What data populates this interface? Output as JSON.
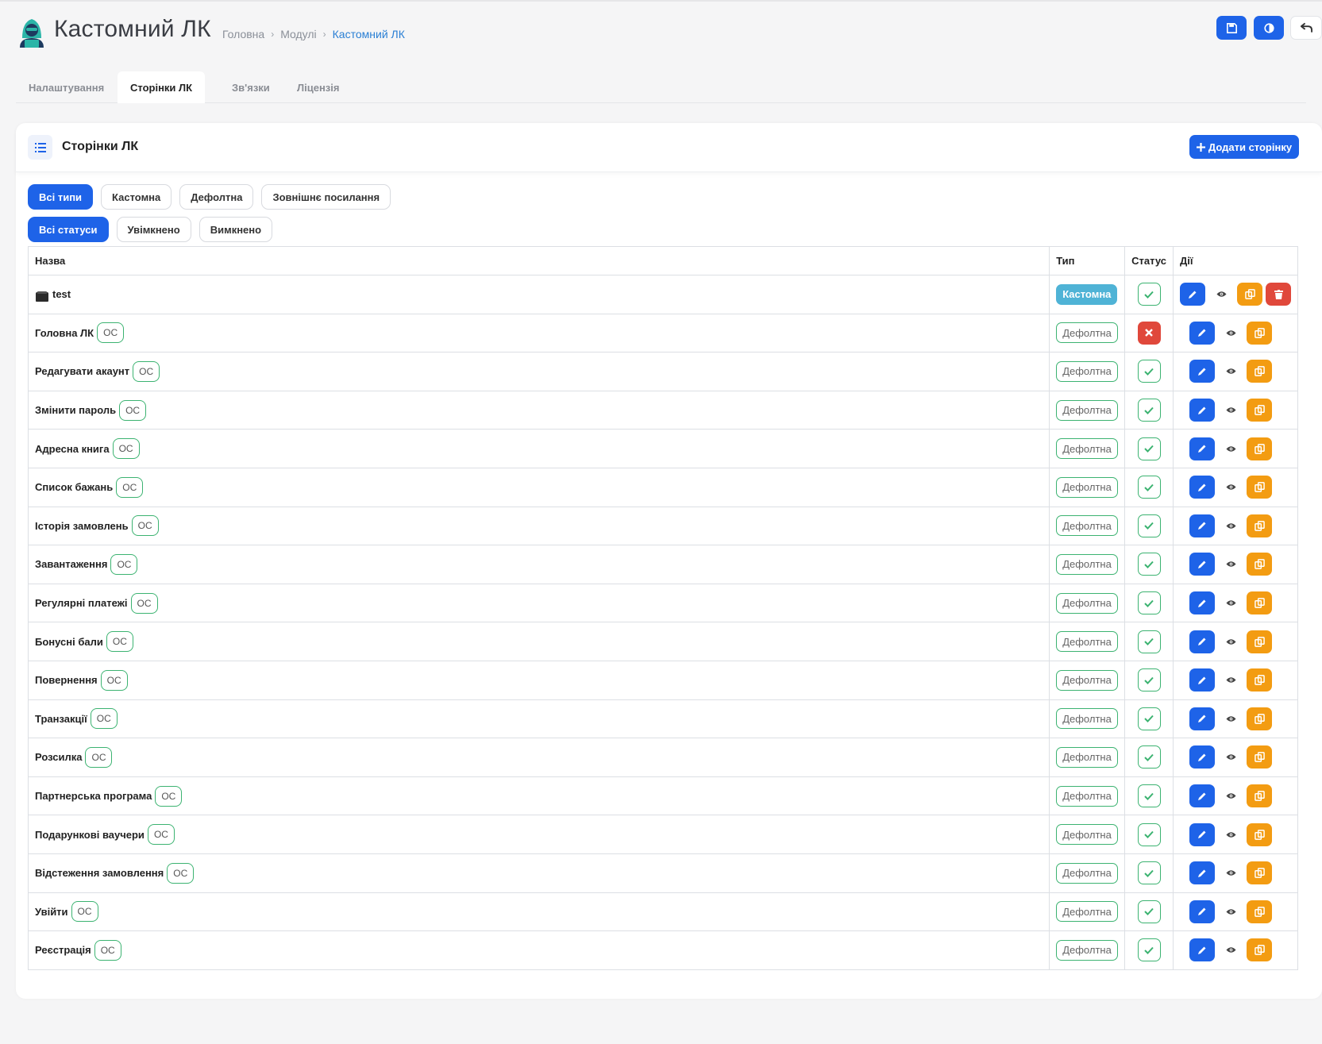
{
  "header": {
    "title": "Кастомний ЛК",
    "breadcrumb": [
      "Головна",
      "Модулі",
      "Кастомний ЛК"
    ]
  },
  "colors": {
    "primary": "#1e63e8",
    "success": "#3cb371",
    "danger": "#e0483b",
    "warning": "#f39c12",
    "info": "#4fb3d6"
  },
  "tabs": [
    "Налаштування",
    "Сторінки ЛК",
    "Зв'язки",
    "Ліцензія"
  ],
  "active_tab": "Сторінки ЛК",
  "card": {
    "title": "Сторінки ЛК",
    "add_button": "Додати сторінку"
  },
  "filters": {
    "types": [
      "Всі типи",
      "Кастомна",
      "Дефолтна",
      "Зовнішнє посилання"
    ],
    "statuses": [
      "Всі статуси",
      "Увімкнено",
      "Вимкнено"
    ],
    "active_type": "Всі типи",
    "active_status": "Всі статуси"
  },
  "table": {
    "columns": [
      "Назва",
      "Тип",
      "Статус",
      "Дії"
    ],
    "rows": [
      {
        "name": "test",
        "badge": "",
        "type": "Кастомна",
        "status": "on",
        "deletable": true,
        "folder_icon": true
      },
      {
        "name": "Головна ЛК",
        "badge": "OC",
        "type": "Дефолтна",
        "status": "off",
        "deletable": false
      },
      {
        "name": "Редагувати акаунт",
        "badge": "OC",
        "type": "Дефолтна",
        "status": "on",
        "deletable": false
      },
      {
        "name": "Змінити пароль",
        "badge": "OC",
        "type": "Дефолтна",
        "status": "on",
        "deletable": false
      },
      {
        "name": "Адресна книга",
        "badge": "OC",
        "type": "Дефолтна",
        "status": "on",
        "deletable": false
      },
      {
        "name": "Список бажань",
        "badge": "OC",
        "type": "Дефолтна",
        "status": "on",
        "deletable": false
      },
      {
        "name": "Історія замовлень",
        "badge": "OC",
        "type": "Дефолтна",
        "status": "on",
        "deletable": false
      },
      {
        "name": "Завантаження",
        "badge": "OC",
        "type": "Дефолтна",
        "status": "on",
        "deletable": false
      },
      {
        "name": "Регулярні платежі",
        "badge": "OC",
        "type": "Дефолтна",
        "status": "on",
        "deletable": false
      },
      {
        "name": "Бонусні бали",
        "badge": "OC",
        "type": "Дефолтна",
        "status": "on",
        "deletable": false
      },
      {
        "name": "Повернення",
        "badge": "OC",
        "type": "Дефолтна",
        "status": "on",
        "deletable": false
      },
      {
        "name": "Транзакції",
        "badge": "OC",
        "type": "Дефолтна",
        "status": "on",
        "deletable": false
      },
      {
        "name": "Розсилка",
        "badge": "OC",
        "type": "Дефолтна",
        "status": "on",
        "deletable": false
      },
      {
        "name": "Партнерська програма",
        "badge": "OC",
        "type": "Дефолтна",
        "status": "on",
        "deletable": false
      },
      {
        "name": "Подарункові ваучери",
        "badge": "OC",
        "type": "Дефолтна",
        "status": "on",
        "deletable": false
      },
      {
        "name": "Відстеження замовлення",
        "badge": "OC",
        "type": "Дефолтна",
        "status": "on",
        "deletable": false
      },
      {
        "name": "Увійти",
        "badge": "OC",
        "type": "Дефолтна",
        "status": "on",
        "deletable": false
      },
      {
        "name": "Реєстрація",
        "badge": "OC",
        "type": "Дефолтна",
        "status": "on",
        "deletable": false
      }
    ]
  }
}
